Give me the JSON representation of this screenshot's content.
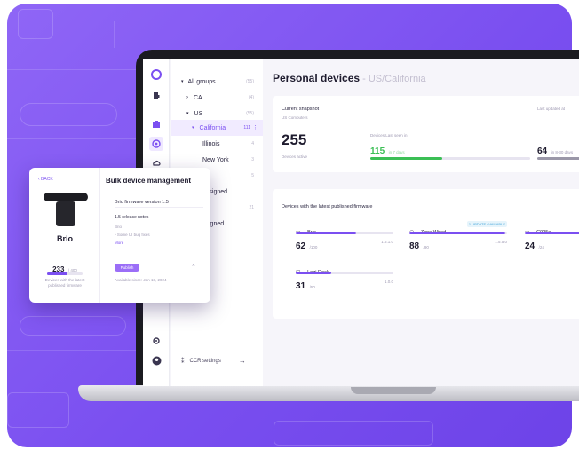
{
  "theme": {
    "accent": "#7b4ff1",
    "green": "#3bbf55",
    "background": "#8f66f6"
  },
  "rail_icons": [
    "logo-icon",
    "devices-icon",
    "rooms-icon",
    "insights-icon",
    "cloud-icon",
    "settings-icon",
    "user-icon"
  ],
  "tree": {
    "rows": [
      {
        "label": "All groups",
        "count": "(55)",
        "chevron": "▾"
      },
      {
        "label": "CA",
        "count": "(4)",
        "chevron": "›"
      },
      {
        "label": "US",
        "count": "(55)",
        "chevron": "▾"
      },
      {
        "label": "California",
        "count": "111",
        "chevron": "▾",
        "selected": true
      },
      {
        "label": "Illinois",
        "count": "4"
      },
      {
        "label": "New York",
        "count": "3"
      },
      {
        "label": "as",
        "count": "5"
      },
      {
        "label": "assigned",
        "count": ""
      },
      {
        "label": "",
        "count": "21"
      },
      {
        "label": "ssigned",
        "count": ""
      }
    ],
    "footer_label": "CCR settings",
    "footer_arrow": "→"
  },
  "main": {
    "title": "Personal devices",
    "breadcrumb": " - US/California",
    "snapshot": {
      "heading": "Current snapshot",
      "sub": "US Computers",
      "total": "255",
      "total_label": "Devices active",
      "seen_label": "Devices Last seen in",
      "seen_value": "115",
      "seen_unit": "in 7 days",
      "last_update_label": "Last updated at",
      "right_value": "64",
      "right_unit": "in 8-30 days",
      "seen_fraction": 0.45
    },
    "firmware": {
      "heading": "Devices with the latest published firmware",
      "items": [
        {
          "icon": "webcam-icon",
          "name": "Brio",
          "value": "62",
          "unit": "/100",
          "extra": "1.5.1.0",
          "fraction": 0.62
        },
        {
          "icon": "headset-icon",
          "name": "Zone Wired",
          "badge": "1 UPDATE AVAILABLE",
          "value": "88",
          "unit": "/90",
          "extra": "1.5.5.0",
          "fraction": 0.98
        },
        {
          "icon": "webcam-icon",
          "name": "C925e",
          "value": "24",
          "unit": "/24",
          "extra": "",
          "fraction": 1.0
        },
        {
          "icon": "dock-icon",
          "name": "Logi Dock",
          "value": "31",
          "unit": "/50",
          "extra": "1.0.0",
          "fraction": 0.36
        }
      ]
    }
  },
  "bulk": {
    "back_label": "‹ BACK",
    "title": "Bulk device management",
    "device_name": "Brio",
    "device_count": "233",
    "device_count_unit": "/ 400",
    "device_caption": "Devices with the latest published firmware",
    "device_fraction": 0.58,
    "fw_title": "Brio firmware version 1.5",
    "fw_release": "1.5 release notes",
    "fw_lines": [
      "Brio",
      "• Some UI bug fixes"
    ],
    "fw_more": "More",
    "publish_label": "Publish",
    "publish_note": "Available since: Jan 18, 2024"
  }
}
